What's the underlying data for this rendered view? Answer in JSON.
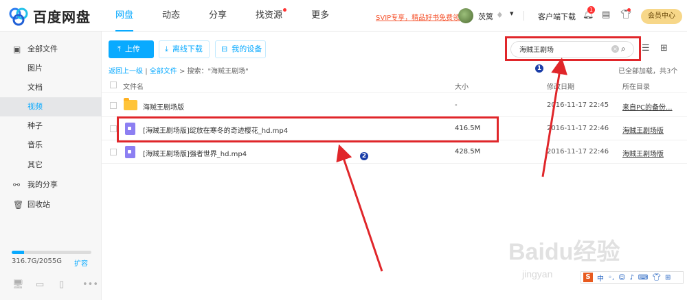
{
  "brand": {
    "name": "百度网盘"
  },
  "nav": [
    {
      "label": "网盘",
      "active": true
    },
    {
      "label": "动态"
    },
    {
      "label": "分享"
    },
    {
      "label": "找资源",
      "dot": true
    },
    {
      "label": "更多"
    }
  ],
  "header": {
    "svip_promo": "SVIP专享，精品好书免费领",
    "username": "茨篱",
    "client_download": "客户端下载",
    "notification_count": "1",
    "member_center": "会员中心"
  },
  "sidebar": {
    "items": [
      {
        "label": "全部文件",
        "icon": "folder-icon"
      },
      {
        "label": "图片"
      },
      {
        "label": "文档"
      },
      {
        "label": "视频",
        "active": true
      },
      {
        "label": "种子"
      },
      {
        "label": "音乐"
      },
      {
        "label": "其它"
      },
      {
        "label": "我的分享",
        "icon": "share-icon"
      },
      {
        "label": "回收站",
        "icon": "trash-icon"
      }
    ],
    "quota_text": "316.7G/2055G",
    "quota_used_fraction": 0.154,
    "expand_label": "扩容"
  },
  "toolbar": {
    "upload": "上传",
    "offline_download": "离线下载",
    "my_devices": "我的设备"
  },
  "search": {
    "value": "海贼王剧场"
  },
  "breadcrumb": {
    "back": "返回上一级",
    "sep": "|",
    "all_files": "全部文件",
    "gt": ">",
    "query_label": "搜索：\"海贼王剧场\""
  },
  "loaded_text": "已全部加载，共3个",
  "table": {
    "headers": {
      "name": "文件名",
      "size": "大小",
      "modified": "修改日期",
      "location": "所在目录"
    },
    "rows": [
      {
        "type": "folder",
        "name": "海贼王剧场版",
        "size": "-",
        "modified": "2016-11-17 22:45",
        "location": "来自PC的备份..."
      },
      {
        "type": "video",
        "name": "[海贼王剧场版]绽放在寒冬的奇迹樱花_hd.mp4",
        "size": "416.5M",
        "modified": "2016-11-17 22:46",
        "location": "海贼王剧场版"
      },
      {
        "type": "video",
        "name": "[海贼王剧场版]强者世界_hd.mp4",
        "size": "428.5M",
        "modified": "2016-11-17 22:46",
        "location": "海贼王剧场版"
      }
    ]
  },
  "annotations": {
    "badge1": "1",
    "badge2": "2"
  },
  "watermark": {
    "main": "Baidu经验",
    "sub": "jingyan"
  },
  "ime": {
    "mode": "中"
  },
  "colors": {
    "accent": "#09aaff",
    "highlight": "#e0262a",
    "badge": "#1a3da8"
  }
}
